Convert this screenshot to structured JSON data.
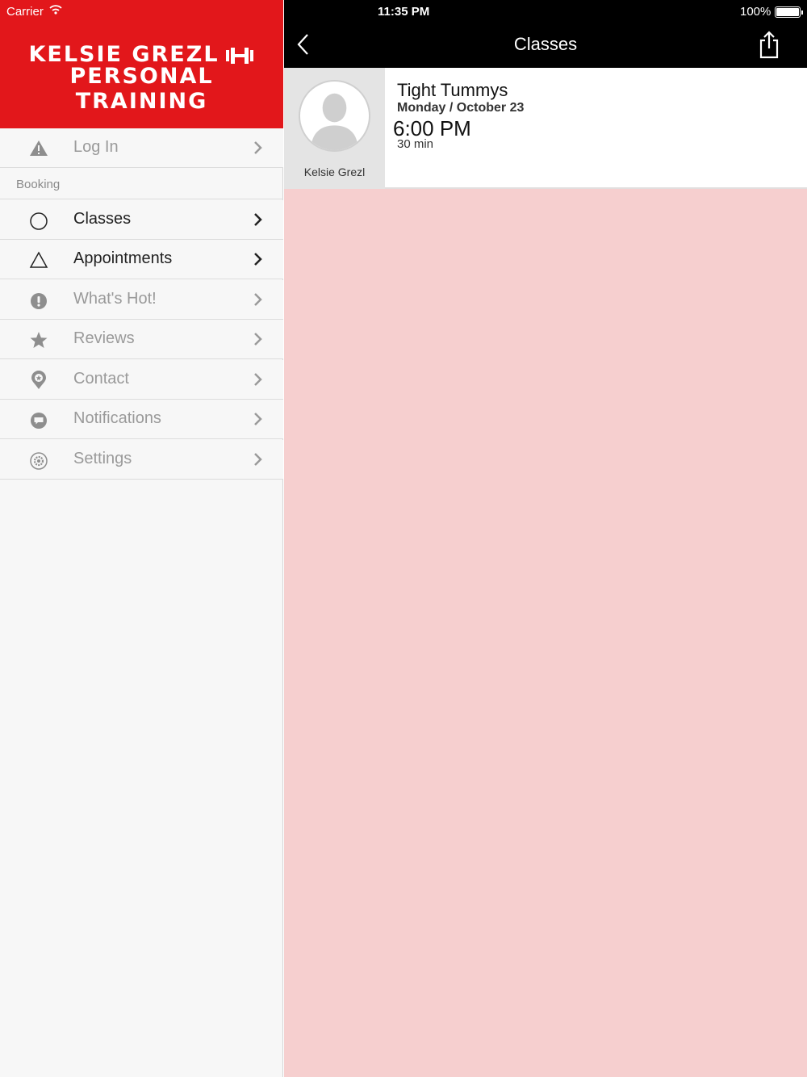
{
  "status_bar": {
    "carrier": "Carrier",
    "time": "11:35 PM",
    "battery": "100%",
    "battery_level": 1.0
  },
  "brand": {
    "line1": "KELSIE GREZL",
    "line2": "PERSONAL TRAINING",
    "color": "#e2171b"
  },
  "sidebar": {
    "login": {
      "label": "Log In",
      "icon": "warning-icon"
    },
    "section_label": "Booking",
    "items": [
      {
        "label": "Classes",
        "icon": "circle-icon",
        "active": true
      },
      {
        "label": "Appointments",
        "icon": "triangle-icon",
        "active": true
      },
      {
        "label": "What's Hot!",
        "icon": "exclamation-icon",
        "active": false
      },
      {
        "label": "Reviews",
        "icon": "star-icon",
        "active": false
      },
      {
        "label": "Contact",
        "icon": "location-pin-icon",
        "active": false
      },
      {
        "label": "Notifications",
        "icon": "chat-bubble-icon",
        "active": false
      },
      {
        "label": "Settings",
        "icon": "gear-icon",
        "active": false
      }
    ]
  },
  "nav": {
    "title": "Classes",
    "back_icon": "chevron-left-icon",
    "share_icon": "share-icon"
  },
  "class_card": {
    "instructor": "Kelsie Grezl",
    "name": "Tight Tummys",
    "date": "Monday / October 23",
    "time": "6:00 PM",
    "duration": "30 min"
  },
  "colors": {
    "content_bg": "#f6cfcf",
    "header_bg": "#000000"
  }
}
